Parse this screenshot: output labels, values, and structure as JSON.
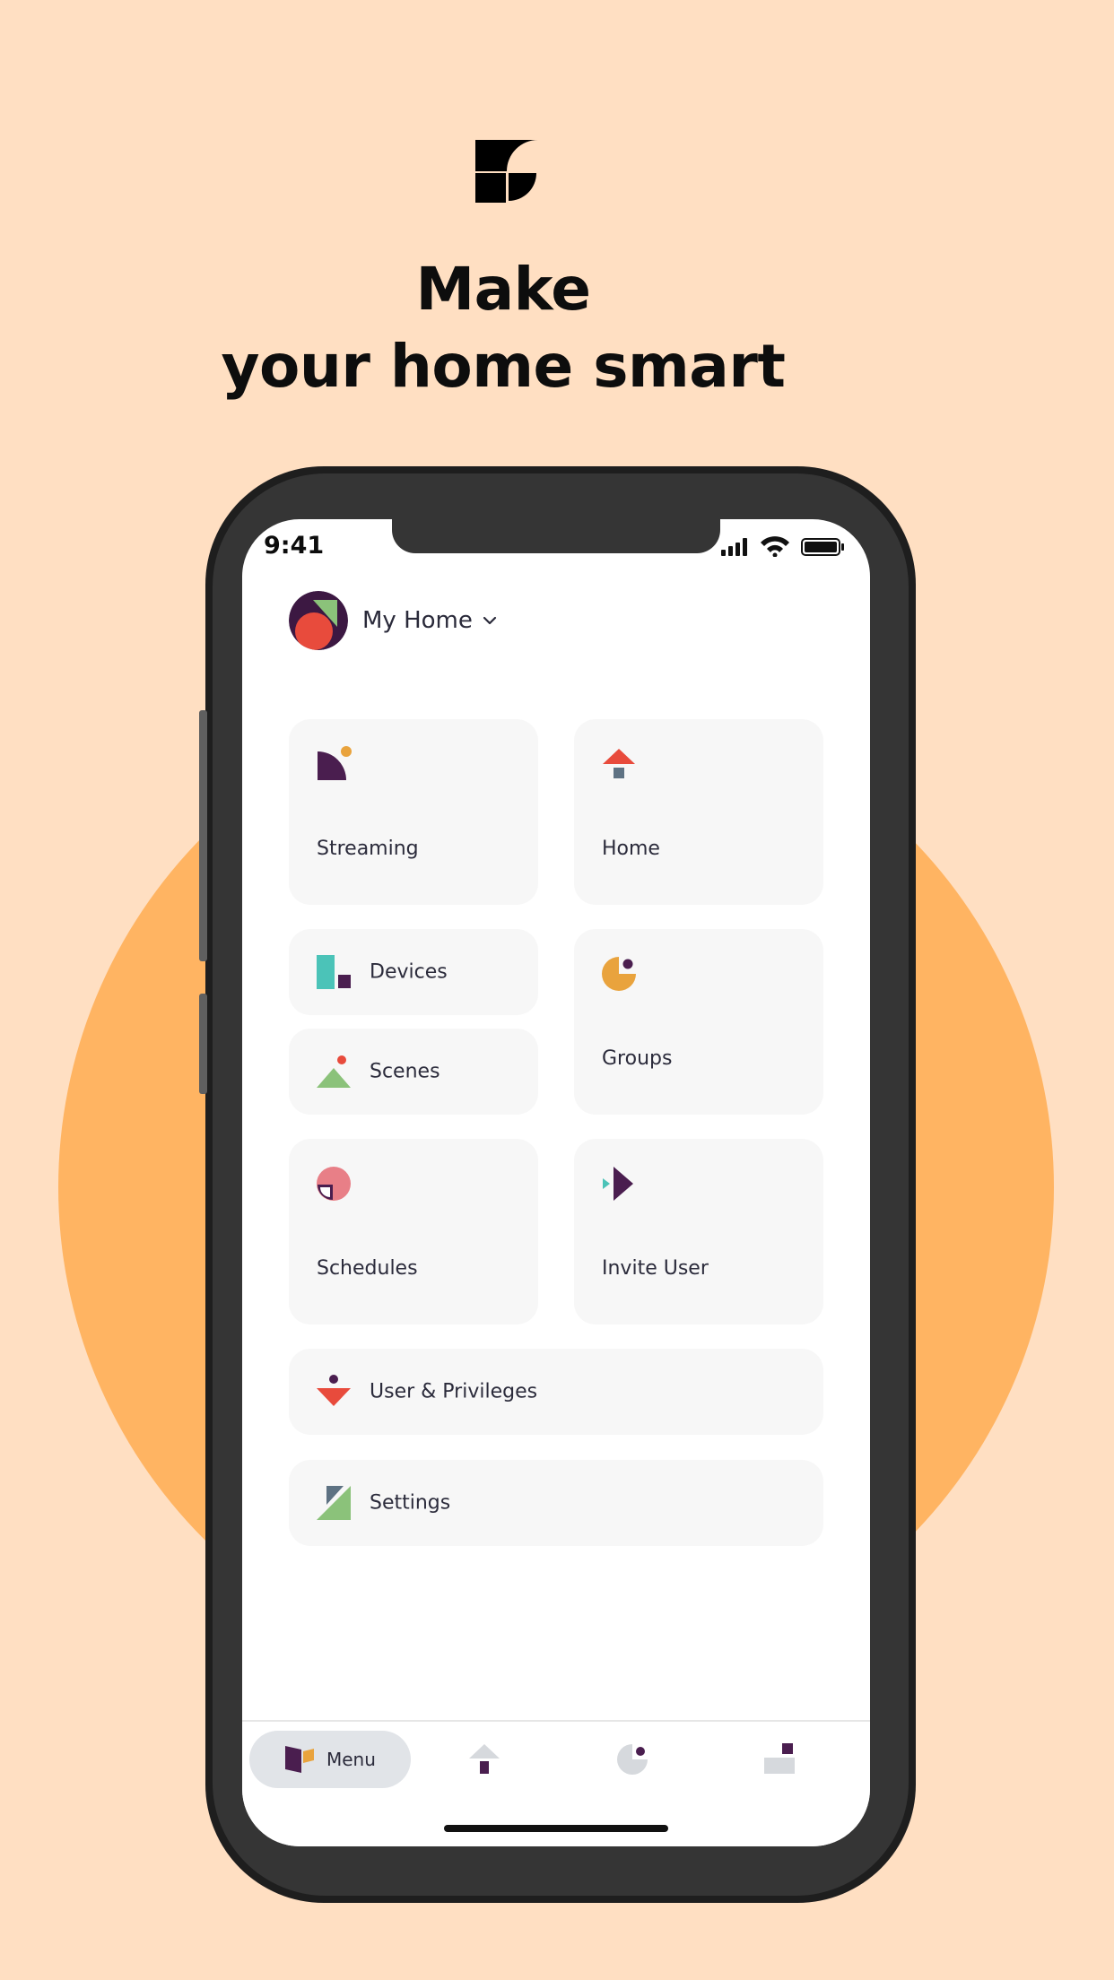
{
  "headline": {
    "line1": "Make",
    "line2": "your home smart"
  },
  "status_bar": {
    "time": "9:41"
  },
  "home": {
    "name": "My Home"
  },
  "tiles": {
    "streaming": "Streaming",
    "home": "Home",
    "devices": "Devices",
    "scenes": "Scenes",
    "groups": "Groups",
    "schedules": "Schedules",
    "invite_user": "Invite User",
    "user_privileges": "User & Privileges",
    "settings": "Settings"
  },
  "tabbar": {
    "menu_label": "Menu"
  },
  "colors": {
    "background": "#FFDFC2",
    "accent_circle": "#FFB462",
    "purple": "#4A1E4F",
    "red": "#E84B3C",
    "teal": "#4BC3B8",
    "orange": "#E9A33D",
    "green": "#8BC27A",
    "pink": "#E87F87",
    "slate": "#5E7283"
  },
  "icons": [
    "app-logo",
    "streaming-icon",
    "home-icon",
    "devices-icon",
    "scenes-icon",
    "groups-icon",
    "schedules-icon",
    "invite-user-icon",
    "user-privileges-icon",
    "settings-icon",
    "menu-icon",
    "chevron-down-icon"
  ]
}
